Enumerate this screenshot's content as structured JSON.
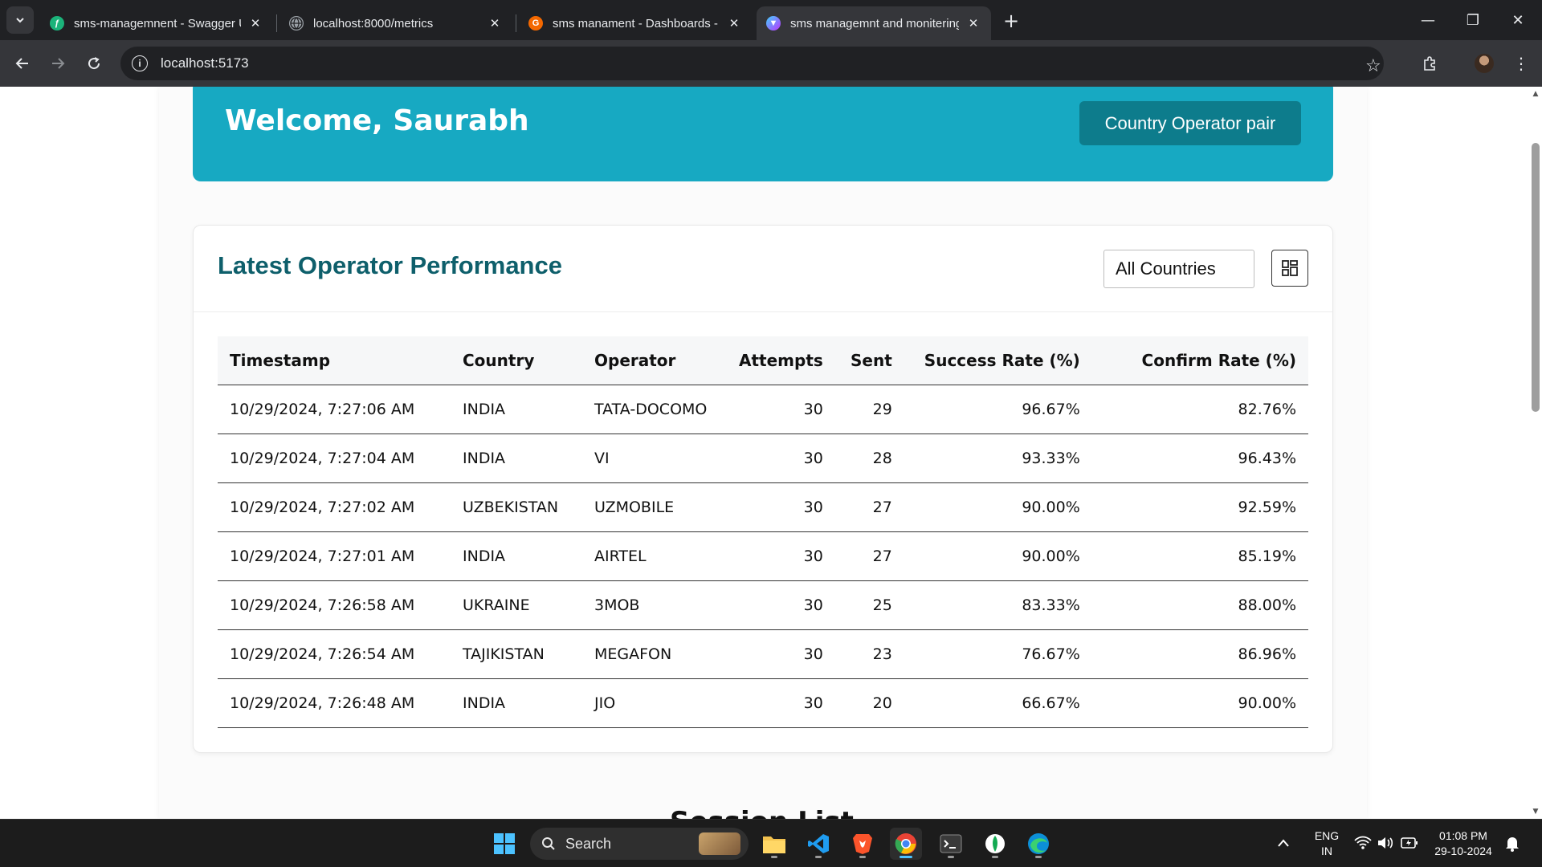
{
  "browser": {
    "tabs": [
      {
        "title": "sms-managemnent - Swagger UI",
        "favicon": "swagger-icon",
        "color": "#1bb37a"
      },
      {
        "title": "localhost:8000/metrics",
        "favicon": "globe-icon",
        "color": "#9aa0a6"
      },
      {
        "title": "sms manament - Dashboards - Grafana",
        "favicon": "grafana-icon",
        "color": "#f46800"
      },
      {
        "title": "sms managemnt and monitering",
        "favicon": "vite-icon",
        "color": "#a259ff",
        "active": true
      }
    ],
    "url": "localhost:5173"
  },
  "hero": {
    "title": "Welcome, Saurabh",
    "button_label": "Country Operator pair",
    "bg_color": "#17a9c2",
    "button_color": "#0d7c8c"
  },
  "performance": {
    "title": "Latest Operator Performance",
    "filter_value": "All Countries",
    "columns": [
      "Timestamp",
      "Country",
      "Operator",
      "Attempts",
      "Sent",
      "Success Rate (%)",
      "Confirm Rate (%)"
    ],
    "rows": [
      [
        "10/29/2024, 7:27:06 AM",
        "INDIA",
        "TATA-DOCOMO",
        "30",
        "29",
        "96.67%",
        "82.76%"
      ],
      [
        "10/29/2024, 7:27:04 AM",
        "INDIA",
        "VI",
        "30",
        "28",
        "93.33%",
        "96.43%"
      ],
      [
        "10/29/2024, 7:27:02 AM",
        "UZBEKISTAN",
        "UZMOBILE",
        "30",
        "27",
        "90.00%",
        "92.59%"
      ],
      [
        "10/29/2024, 7:27:01 AM",
        "INDIA",
        "AIRTEL",
        "30",
        "27",
        "90.00%",
        "85.19%"
      ],
      [
        "10/29/2024, 7:26:58 AM",
        "UKRAINE",
        "3MOB",
        "30",
        "25",
        "83.33%",
        "88.00%"
      ],
      [
        "10/29/2024, 7:26:54 AM",
        "TAJIKISTAN",
        "MEGAFON",
        "30",
        "23",
        "76.67%",
        "86.96%"
      ],
      [
        "10/29/2024, 7:26:48 AM",
        "INDIA",
        "JIO",
        "30",
        "20",
        "66.67%",
        "90.00%"
      ]
    ],
    "title_color": "#0e5f6b"
  },
  "next_section": {
    "title": "Session List"
  },
  "taskbar": {
    "search_label": "Search",
    "lang_top": "ENG",
    "lang_bottom": "IN",
    "time": "01:08 PM",
    "date": "29-10-2024"
  }
}
